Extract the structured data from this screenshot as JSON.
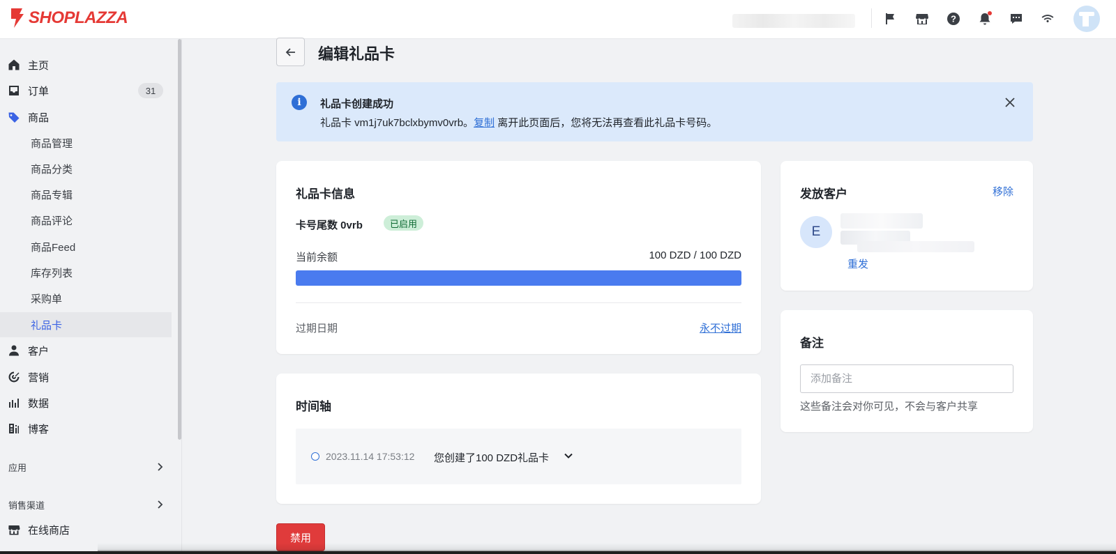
{
  "brand": {
    "name": "SHOPLAZZA",
    "color": "#e53935"
  },
  "topbar": {
    "icons": [
      "flag-icon",
      "store-icon",
      "help-icon",
      "bell-icon",
      "chat-icon",
      "wifi-icon"
    ]
  },
  "sidebar": {
    "items": [
      {
        "label": "主页",
        "icon": "home-icon"
      },
      {
        "label": "订单",
        "icon": "inbox-icon",
        "badge": "31"
      },
      {
        "label": "商品",
        "icon": "tag-icon"
      }
    ],
    "products_sub": [
      {
        "label": "商品管理"
      },
      {
        "label": "商品分类"
      },
      {
        "label": "商品专辑"
      },
      {
        "label": "商品评论"
      },
      {
        "label": "商品Feed"
      },
      {
        "label": "库存列表"
      },
      {
        "label": "采购单"
      },
      {
        "label": "礼品卡",
        "active": true
      }
    ],
    "items2": [
      {
        "label": "客户",
        "icon": "user-icon"
      },
      {
        "label": "营销",
        "icon": "target-icon"
      },
      {
        "label": "数据",
        "icon": "bar-chart-icon"
      },
      {
        "label": "博客",
        "icon": "blog-icon"
      }
    ],
    "sections": [
      {
        "label": "应用"
      },
      {
        "label": "销售渠道"
      }
    ],
    "channel_items": [
      {
        "label": "在线商店",
        "icon": "storefront-icon"
      }
    ]
  },
  "page": {
    "title": "编辑礼品卡"
  },
  "banner": {
    "title": "礼品卡创建成功",
    "text_prefix": "礼品卡 vm1j7uk7bclxbymv0vrb。",
    "copy_link": "复制",
    "text_suffix": " 离开此页面后，您将无法再查看此礼品卡号码。"
  },
  "gift_card": {
    "title": "礼品卡信息",
    "suffix_label": "卡号尾数 0vrb",
    "status": "已启用",
    "balance_label": "当前余额",
    "balance_value": "100 DZD / 100 DZD",
    "balance_fraction": 1.0,
    "expiry_label": "过期日期",
    "expiry_value": "永不过期"
  },
  "timeline": {
    "title": "时间轴",
    "events": [
      {
        "time": "2023.11.14 17:53:12",
        "description": "您创建了100 DZD礼品卡"
      }
    ]
  },
  "customer": {
    "title": "发放客户",
    "remove_label": "移除",
    "avatar_initial": "E",
    "resend_label": "重发"
  },
  "notes": {
    "title": "备注",
    "placeholder": "添加备注",
    "value": "",
    "help": "这些备注会对你可见，不会与客户共享"
  },
  "actions": {
    "disable_label": "禁用"
  },
  "colors": {
    "accent": "#2f6fd6",
    "progress": "#4a7bef",
    "danger": "#e03b3b",
    "banner_bg": "#dbe9fb",
    "status_bg": "#cdeed8"
  }
}
